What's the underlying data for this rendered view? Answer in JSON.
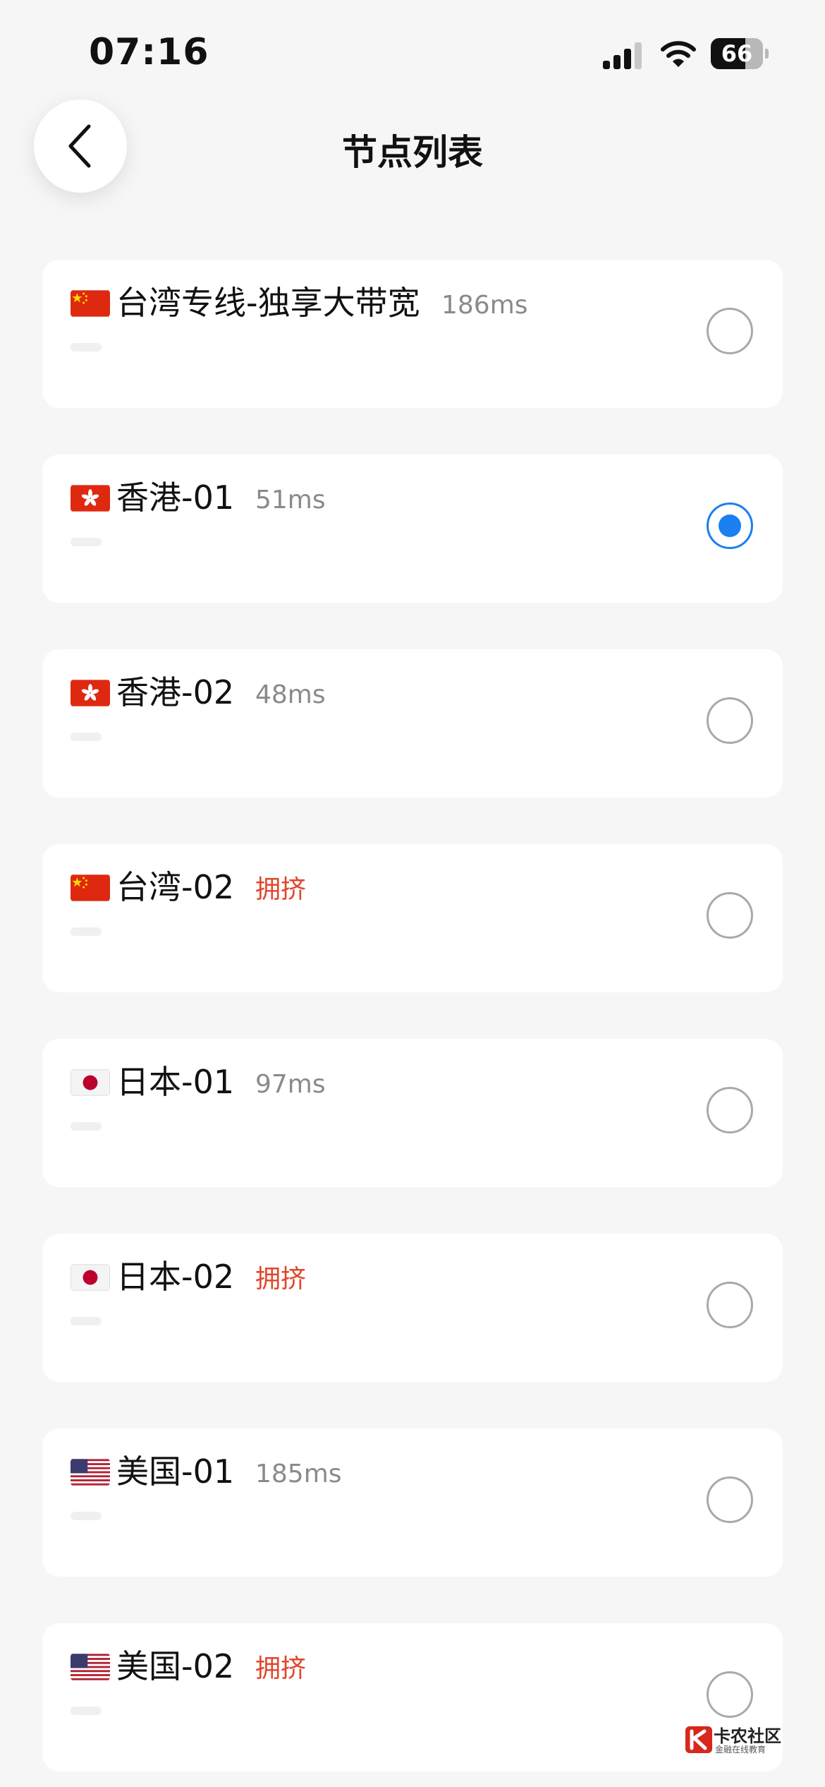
{
  "status_bar": {
    "time": "07:16",
    "battery": "66",
    "battery_level": 0.66
  },
  "header": {
    "title": "节点列表"
  },
  "nodes": [
    {
      "flag": "cn",
      "name": "台湾专线-独享大带宽",
      "latency": "186ms",
      "state": "normal",
      "selected": false
    },
    {
      "flag": "hk",
      "name": "香港-01",
      "latency": "51ms",
      "state": "normal",
      "selected": true
    },
    {
      "flag": "hk",
      "name": "香港-02",
      "latency": "48ms",
      "state": "normal",
      "selected": false
    },
    {
      "flag": "cn",
      "name": "台湾-02",
      "latency": "拥挤",
      "state": "crowded",
      "selected": false
    },
    {
      "flag": "jp",
      "name": "日本-01",
      "latency": "97ms",
      "state": "normal",
      "selected": false
    },
    {
      "flag": "jp",
      "name": "日本-02",
      "latency": "拥挤",
      "state": "crowded",
      "selected": false
    },
    {
      "flag": "us",
      "name": "美国-01",
      "latency": "185ms",
      "state": "normal",
      "selected": false
    },
    {
      "flag": "us",
      "name": "美国-02",
      "latency": "拥挤",
      "state": "crowded",
      "selected": false
    }
  ],
  "colors": {
    "accent": "#1a7ff0",
    "crowded": "#e0472c",
    "latency": "#8a8a8a",
    "background": "#f6f6f6"
  },
  "watermark": {
    "title": "卡农社区",
    "subtitle": "金融在线教育"
  }
}
